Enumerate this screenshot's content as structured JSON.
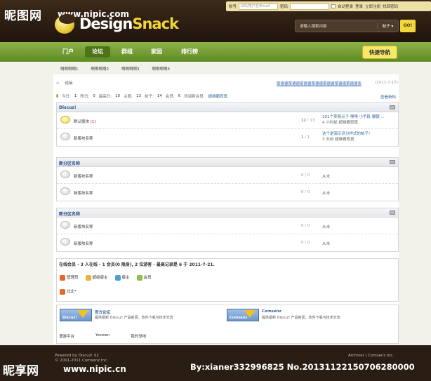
{
  "watermark": {
    "top_text": "昵图网",
    "top_url": "www.nipic.com",
    "bottom_text": "昵享网",
    "bottom_url": "www.nipic.cn",
    "code": "By:xianer332996825 No.20131122150706280000"
  },
  "brand": {
    "part1": "Design",
    "part2": "Snack"
  },
  "login": {
    "account_label": "帐号",
    "account_placeholder": "UID/用户名/Email",
    "password_label": "密码",
    "auto_login": "自动登录",
    "login_btn": "登录",
    "register": "立即注册",
    "forgot": "找回密码"
  },
  "search": {
    "placeholder": "请输入搜索内容",
    "scope": "帖子 ▾",
    "button": "GO!"
  },
  "nav": {
    "items": [
      "门户",
      "论坛",
      "群组",
      "家园",
      "排行榜"
    ],
    "quick": "快捷导航"
  },
  "subnav": [
    "啊啊啊啊1",
    "啊啊啊啊2",
    "啊啊啊啊3",
    "啊啊啊啊4"
  ],
  "breadcrumb": {
    "current": "论坛"
  },
  "notice": {
    "text": "菜德德菜德德菜德德菜德德菜德德菜德德菜德德系",
    "date": "(2011-7-17)"
  },
  "stats": {
    "today_label": "今日:",
    "today": "1",
    "yesterday_label": "昨日:",
    "yesterday": "0",
    "max_label": "最高日:",
    "max": "10",
    "threads_label": "主题:",
    "threads": "13",
    "posts_label": "帖子:",
    "posts": "14",
    "members_label": "会员:",
    "members": "6",
    "welcome": "欢迎新会员:",
    "new_member": "超雄霸寂寞",
    "link": "查看新帖"
  },
  "sections": [
    {
      "title": "Discuz!",
      "forums": [
        {
          "name": "默认版块",
          "today": "(1)",
          "threads": "12",
          "posts": "13",
          "last_title": "101个卖萌点子 嘿嘿 小手段 骗银 ...",
          "last_meta": "4 小时前 超雄霸寂寞",
          "is_new": true
        },
        {
          "name": "新版块名称",
          "threads": "1",
          "posts": "1",
          "last_title": "这个是演示评分样式的帖子!",
          "last_meta": "3 天前 超雄霸寂寞",
          "is_new": false
        }
      ]
    },
    {
      "title": "新分区名称",
      "forums": [
        {
          "name": "新版块名称",
          "threads": "0",
          "posts": "0",
          "never": "从未"
        },
        {
          "name": "新版块名称",
          "threads": "0",
          "posts": "0",
          "never": "从未"
        }
      ]
    },
    {
      "title": "新分区名称",
      "forums": [
        {
          "name": "新版块名称",
          "threads": "0",
          "posts": "0",
          "never": "从未"
        },
        {
          "name": "新版块名称",
          "threads": "0",
          "posts": "0",
          "never": "从未"
        }
      ]
    }
  ],
  "online": {
    "title": "在线会员 - 3 人在线 - 1 会员(0 隐身), 2 位游客 - 最高记录是 6 于 2011-7-21.",
    "legend": [
      "管理员",
      "超级版主",
      "版主",
      "会员"
    ],
    "user": "北北*"
  },
  "links": {
    "partners": [
      {
        "logo": "Discuz!",
        "name": "官方论坛",
        "desc": "提供最新 Discuz! 产品新闻、软件下载与技术交流"
      },
      {
        "logo": "Comsenz",
        "name": "Comsenz",
        "desc": "提供最新 Discuz! 产品新闻、软件下载与技术交流"
      }
    ],
    "text_links": [
      "漫游平台",
      "Yeswan",
      "我的领地"
    ]
  },
  "footer": {
    "powered": "Powered by Discuz! X2",
    "copyright": "© 2001-2011 Comsenz Inc.",
    "right": "Archiver | Comsenz Inc."
  }
}
